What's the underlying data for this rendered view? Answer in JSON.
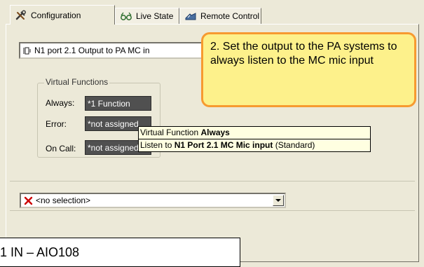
{
  "tabs": [
    {
      "label": "Configuration",
      "icon": "tools-icon",
      "active": true
    },
    {
      "label": "Live State",
      "icon": "glasses-icon",
      "active": false
    },
    {
      "label": "Remote Control",
      "icon": "remote-icon",
      "active": false
    }
  ],
  "output_select": {
    "value": "N1 port 2.1 Output to PA MC in",
    "icon": "output-port-icon"
  },
  "virtual_functions": {
    "title": "Virtual Functions",
    "rows": [
      {
        "label": "Always:",
        "value": "*1 Function"
      },
      {
        "label": "Error:",
        "value": "*not assigned"
      },
      {
        "label": "On Call:",
        "value": "*not assigned"
      }
    ]
  },
  "tooltip": {
    "line1_prefix": "Virtual Function ",
    "line1_bold": "Always",
    "line2_prefix": "Listen to ",
    "line2_bold": "N1 Port 2.1  MC Mic input",
    "line2_suffix": " (Standard)"
  },
  "selection_combo": {
    "value": "<no selection>",
    "icon": "red-x-icon",
    "icon_color": "#cc0000"
  },
  "callout": {
    "text": "2.  Set the output to the PA systems to always listen to the MC mic input",
    "fill_color": "#fdf18b",
    "border_color": "#f79a30"
  },
  "bottom_label": "1 IN – AIO108"
}
